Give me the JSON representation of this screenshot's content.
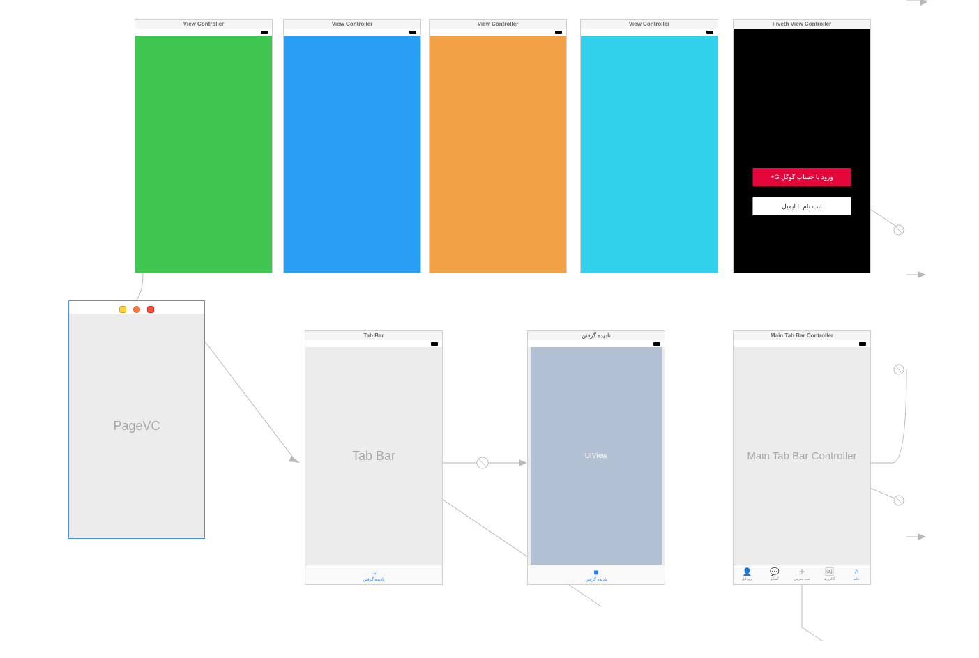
{
  "top_scenes": [
    {
      "title": "View Controller",
      "color": "green"
    },
    {
      "title": "View Controller",
      "color": "blue"
    },
    {
      "title": "View Controller",
      "color": "orange"
    },
    {
      "title": "View Controller",
      "color": "cyan"
    }
  ],
  "login_scene": {
    "title": "Fiveth View Controller",
    "google_button": "ورود با حساب گوگل  G+",
    "email_button": "ثبت نام با ایمیل"
  },
  "pagevc": {
    "label": "PageVC"
  },
  "tabbar_scene": {
    "title": "Tab Bar",
    "body_label": "Tab Bar",
    "tab_label": "نادیده گرفتن"
  },
  "uiview_scene": {
    "title": "نادیده گرفتن",
    "body_label": "UIView",
    "tab_label": "نادیده گرفتن"
  },
  "main_tab_scene": {
    "title": "Main Tab Bar Controller",
    "body_label": "Main Tab Bar Controller",
    "tabs": [
      {
        "label": "خانه",
        "icon": "⌂",
        "active": true
      },
      {
        "label": "گالری‌ها",
        "icon": "🖼",
        "active": false
      },
      {
        "label": "ثبت مدرس",
        "icon": "＋",
        "active": false
      },
      {
        "label": "گفتگو",
        "icon": "💬",
        "active": false
      },
      {
        "label": "پروفایل",
        "icon": "👤",
        "active": false
      }
    ]
  }
}
